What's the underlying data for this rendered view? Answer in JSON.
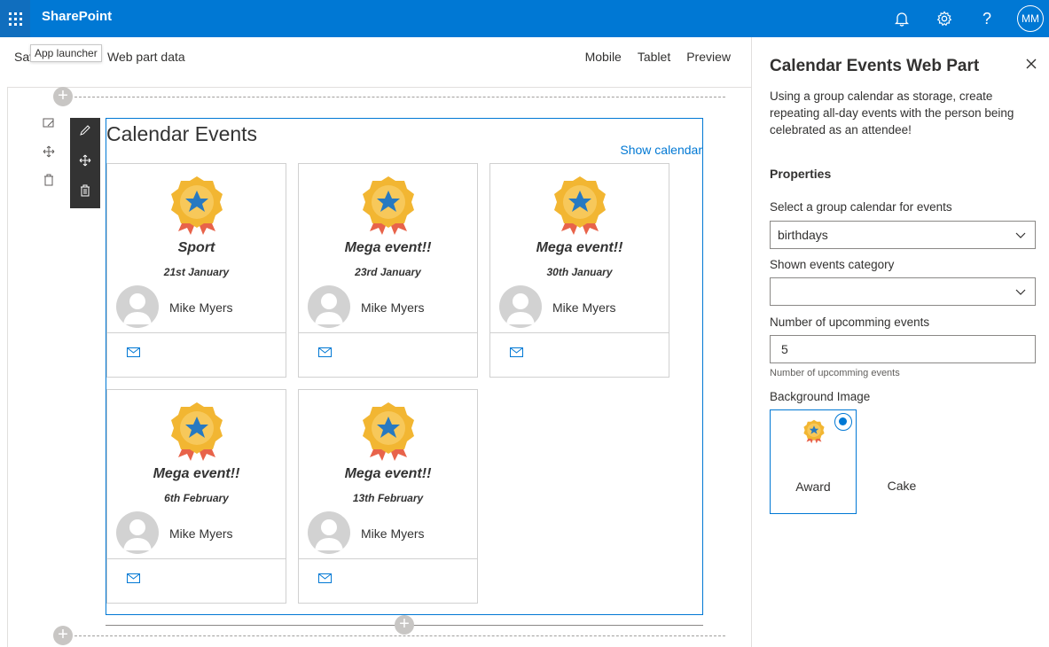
{
  "topbar": {
    "brand": "SharePoint",
    "icons": [
      "bell-icon",
      "gear-icon",
      "help-icon"
    ],
    "user_initials": "MM",
    "accent": "#0078d4"
  },
  "commandbar": {
    "save_label": "Sav",
    "tooltip": "App launcher",
    "webpart_data": "Web part data",
    "mobile": "Mobile",
    "tablet": "Tablet",
    "preview": "Preview"
  },
  "webpart": {
    "title": "Calendar Events",
    "show_calendar": "Show calendar",
    "cards": [
      {
        "title": "Sport",
        "date": "21st January",
        "person": "Mike Myers"
      },
      {
        "title": "Mega event!!",
        "date": "23rd January",
        "person": "Mike Myers"
      },
      {
        "title": "Mega event!!",
        "date": "30th January",
        "person": "Mike Myers"
      },
      {
        "title": "Mega event!!",
        "date": "6th February",
        "person": "Mike Myers"
      },
      {
        "title": "Mega event!!",
        "date": "13th February",
        "person": "Mike Myers"
      }
    ]
  },
  "pane": {
    "title": "Calendar Events Web Part",
    "description": "Using a group calendar as storage, create repeating all-day events with the person being celebrated as an attendee!",
    "group": "Properties",
    "calendar_label": "Select a group calendar for events",
    "calendar_value": "birthdays",
    "category_label": "Shown events category",
    "category_value": "",
    "count_label": "Number of upcomming events",
    "count_value": "5",
    "count_hint": "Number of upcomming events",
    "bg_label": "Background Image",
    "bg_options": [
      {
        "label": "Award",
        "selected": true
      },
      {
        "label": "Cake",
        "selected": false
      }
    ]
  }
}
